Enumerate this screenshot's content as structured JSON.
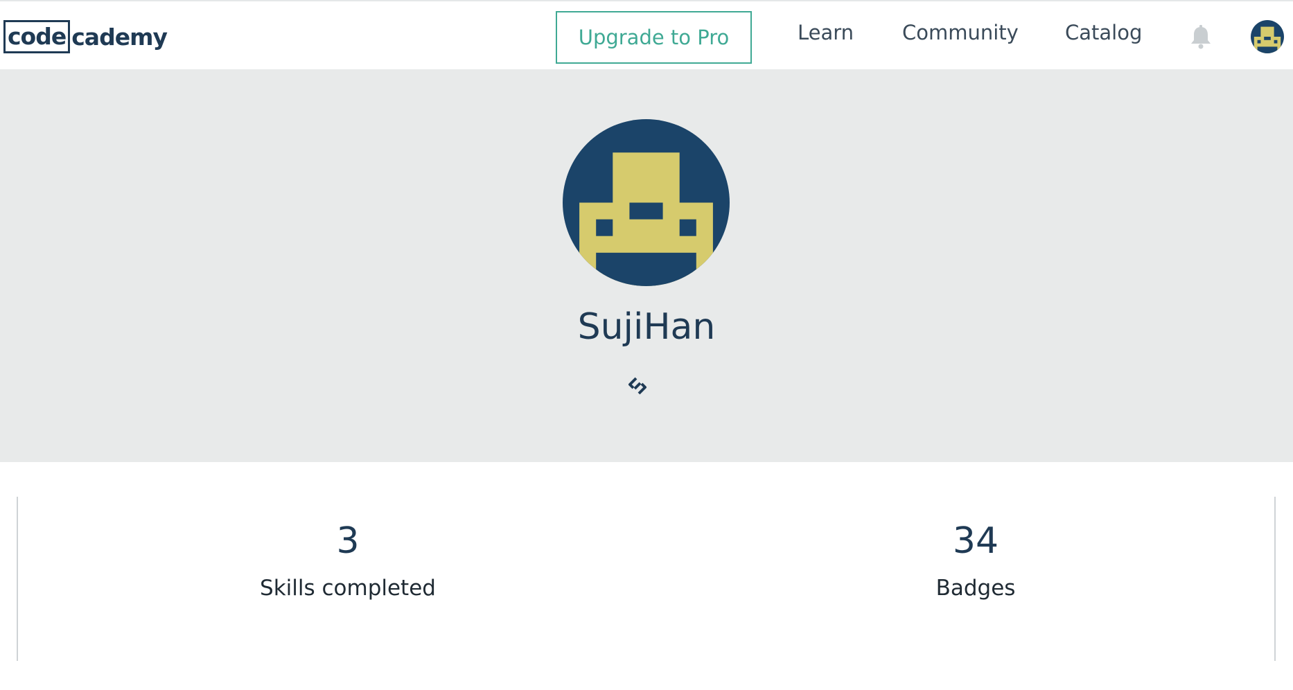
{
  "header": {
    "logo": {
      "box_text": "code",
      "rest_text": "cademy"
    },
    "upgrade_label": "Upgrade to Pro",
    "nav": [
      {
        "label": "Learn"
      },
      {
        "label": "Community"
      },
      {
        "label": "Catalog"
      }
    ],
    "icons": {
      "notifications": "bell-icon",
      "profile": "avatar"
    }
  },
  "profile": {
    "username": "SujiHan",
    "link_icon": "link-icon",
    "avatar_colors": {
      "background": "#1b4469",
      "figure": "#d6cb6d"
    }
  },
  "stats": [
    {
      "value": "3",
      "label": "Skills completed"
    },
    {
      "value": "34",
      "label": "Badges"
    }
  ],
  "colors": {
    "accent": "#3fa994",
    "brand_navy": "#1f3a54",
    "hero_bg": "#e8eaea"
  }
}
